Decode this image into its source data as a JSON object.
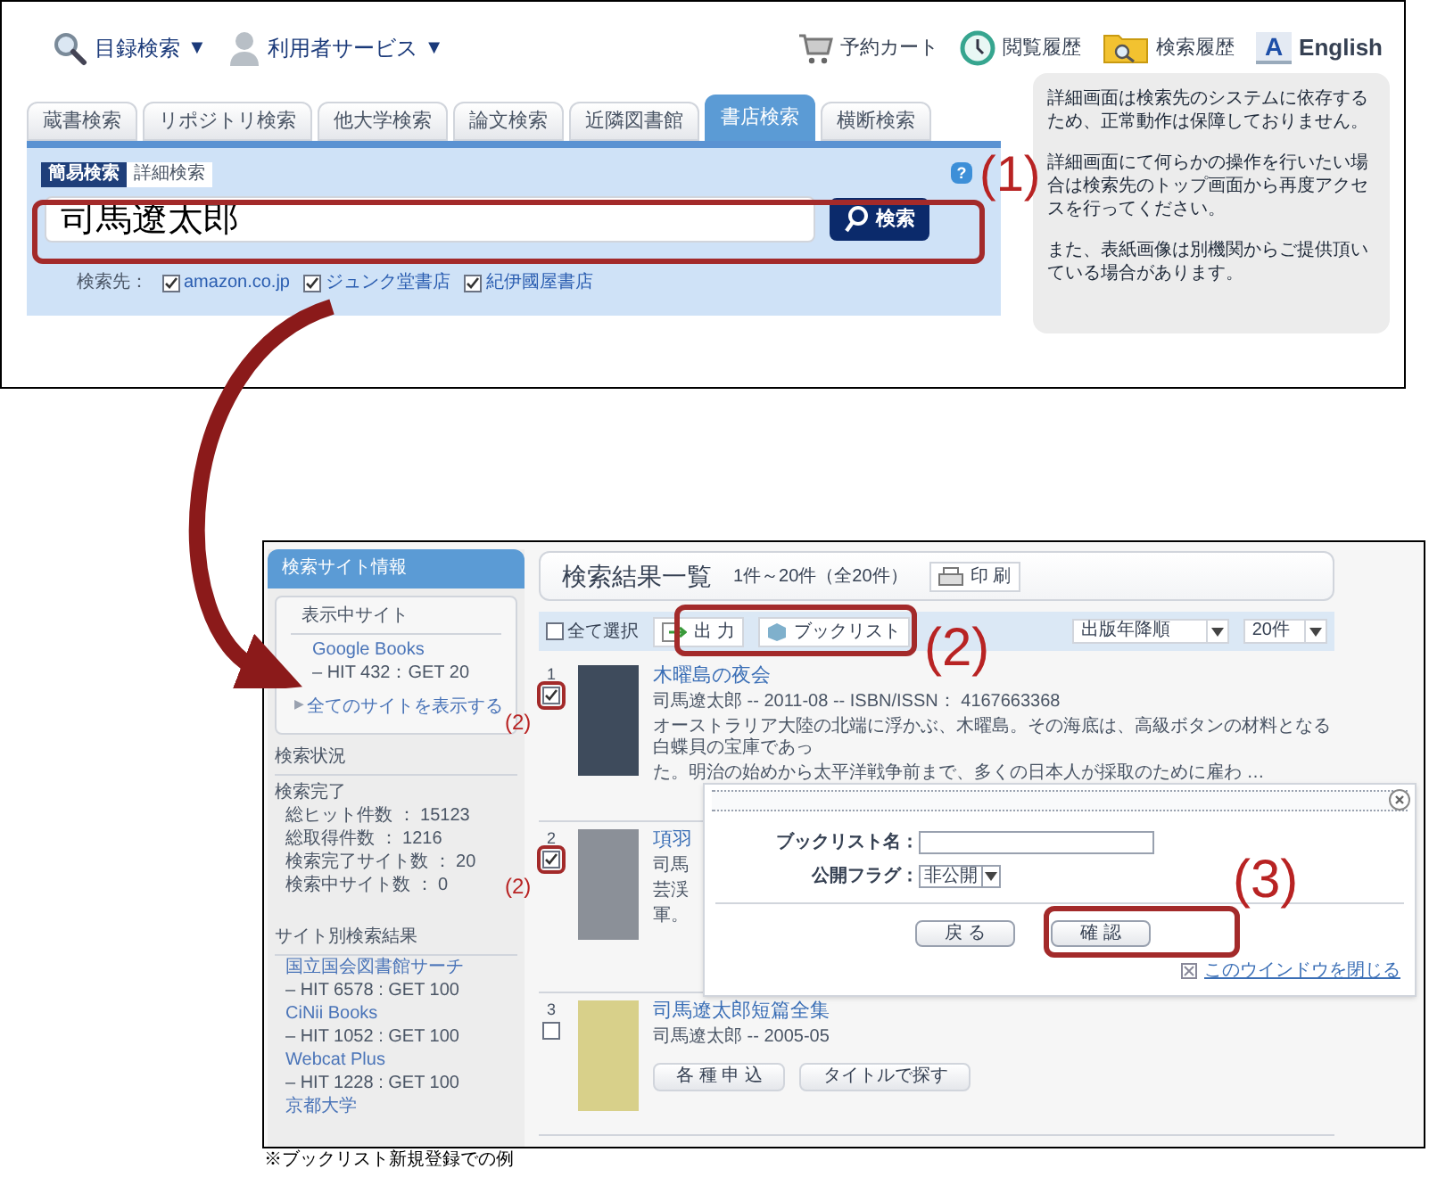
{
  "top_panel": {
    "header_menus": [
      {
        "label": "目録検索",
        "caret": "▼",
        "kind": "search"
      },
      {
        "label": "利用者サービス",
        "caret": "▼",
        "kind": "user"
      }
    ],
    "header_links": [
      {
        "label": "予約カート",
        "kind": "cart"
      },
      {
        "label": "閲覧履歴",
        "kind": "clock"
      },
      {
        "label": "検索履歴",
        "kind": "folder"
      },
      {
        "label": "English",
        "kind": "letter",
        "icon_text": "A"
      }
    ],
    "tabs": [
      {
        "label": "蔵書検索",
        "selected": false
      },
      {
        "label": "リポジトリ検索",
        "selected": false
      },
      {
        "label": "他大学検索",
        "selected": false
      },
      {
        "label": "論文検索",
        "selected": false
      },
      {
        "label": "近隣図書館",
        "selected": false
      },
      {
        "label": "書店検索",
        "selected": true
      },
      {
        "label": "横断検索",
        "selected": false
      }
    ],
    "mode_tabs": [
      {
        "label": "簡易検索",
        "selected": true
      },
      {
        "label": "詳細検索",
        "selected": false
      }
    ],
    "search": {
      "value": "司馬遼太郎",
      "button": "検索"
    },
    "help_icon": "?",
    "annotation": "(1)",
    "targets_label": "検索先：",
    "targets": [
      {
        "label": "amazon.co.jp",
        "checked": true
      },
      {
        "label": "ジュンク堂書店",
        "checked": true
      },
      {
        "label": "紀伊國屋書店",
        "checked": true
      }
    ],
    "notes": [
      "詳細画面は検索先のシステムに依存するため、正常動作は保障しておりません。",
      "詳細画面にて何らかの操作を行いたい場合は検索先のトップ画面から再度アクセスを行ってください。",
      "また、表紙画像は別機関からご提供頂いている場合があります。"
    ]
  },
  "results_panel": {
    "sidebar": {
      "title": "検索サイト情報",
      "current_heading": "表示中サイト",
      "current_sites": [
        {
          "name": "Google Books",
          "stats": "– HIT 432：GET 20"
        }
      ],
      "show_all_marker": "▶",
      "show_all": "全てのサイトを表示する",
      "status_heading": "検索状況",
      "status_lines": [
        "検索完了",
        "総ヒット件数 ： 15123",
        "総取得件数 ： 1216",
        "検索完了サイト数 ： 20",
        "検索中サイト数 ： 0"
      ],
      "by_site_heading": "サイト別検索結果",
      "by_site": [
        {
          "name": "国立国会図書館サーチ",
          "stats": "– HIT 6578 : GET 100"
        },
        {
          "name": "CiNii Books",
          "stats": "– HIT 1052 : GET 100"
        },
        {
          "name": "Webcat Plus",
          "stats": "– HIT 1228 : GET 100"
        },
        {
          "name": "京都大学"
        }
      ]
    },
    "header": {
      "title": "検索結果一覧",
      "range": "1件～20件（全20件）",
      "print": "印 刷"
    },
    "toolbar": {
      "select_all": {
        "label": "全て選択",
        "checked": false
      },
      "export": "出 力",
      "booklist": "ブックリスト",
      "sort": "出版年降順",
      "per_page": "20件",
      "annotation": "(2)"
    },
    "results": [
      {
        "number": "1",
        "checked": true,
        "annotation": "(2)",
        "title": "木曜島の夜会",
        "meta": "司馬遼太郎 -- 2011-08 -- ISBN/ISSN： 4167663368",
        "description": [
          "オーストラリア大陸の北端に浮かぶ、木曜島。その海底は、高級ボタンの材料となる白蝶貝の宝庫であっ",
          "た。明治の始めから太平洋戦争前まで、多くの日本人が採取のために雇わ …"
        ]
      },
      {
        "number": "2",
        "checked": true,
        "annotation": "(2)",
        "title": "項羽",
        "meta": "司馬",
        "description": [
          "芸渓",
          "軍。"
        ]
      },
      {
        "number": "3",
        "checked": false,
        "title": "司馬遼太郎短篇全集",
        "meta": "司馬遼太郎 -- 2005-05",
        "buttons": [
          "各 種 申 込",
          "タイトルで探す"
        ]
      }
    ],
    "dialog": {
      "name_label": "ブックリスト名：",
      "flag_label": "公開フラグ：",
      "flag_value": "非公開",
      "buttons": [
        "戻 る",
        "確 認"
      ],
      "annotation": "(3)",
      "close_link": "このウインドウを閉じる"
    }
  },
  "caption": "※ブックリスト新規登録での例"
}
